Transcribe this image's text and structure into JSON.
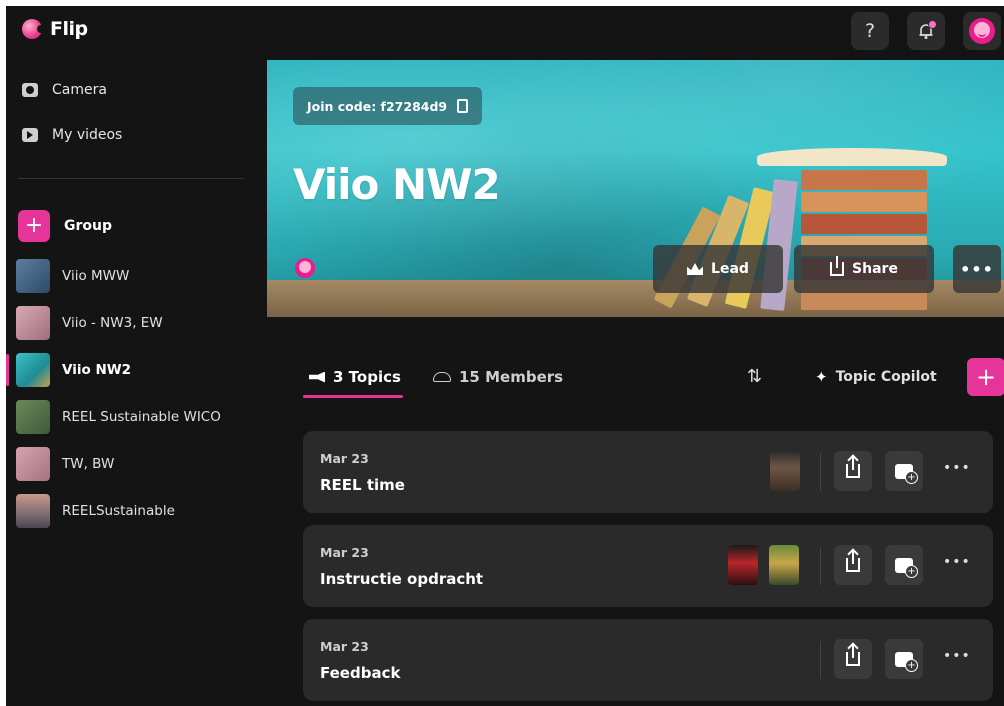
{
  "app": {
    "name": "Flip"
  },
  "topbar": {
    "help_icon": "?"
  },
  "sidebar": {
    "links": [
      {
        "label": "Camera",
        "icon": "camera-icon"
      },
      {
        "label": "My videos",
        "icon": "video-icon"
      }
    ],
    "group_add_label": "Group",
    "groups": [
      {
        "label": "Viio MWW",
        "active": false
      },
      {
        "label": "Viio - NW3, EW",
        "active": false
      },
      {
        "label": "Viio NW2",
        "active": true
      },
      {
        "label": "REEL Sustainable WICO",
        "active": false
      },
      {
        "label": "TW, BW",
        "active": false
      },
      {
        "label": "REELSustainable",
        "active": false
      }
    ]
  },
  "hero": {
    "join_code": "Join code: f27284d9",
    "title": "Viio NW2",
    "lead_label": "Lead",
    "share_label": "Share",
    "more_label": "•••"
  },
  "tabs": {
    "topics_label": "3 Topics",
    "members_label": "15 Members",
    "sort_icon": "⇅",
    "copilot_label": "Topic Copilot",
    "add_label": "+"
  },
  "topics": [
    {
      "date": "Mar 23",
      "title": "REEL time",
      "more": "•••"
    },
    {
      "date": "Mar 23",
      "title": "Instructie opdracht",
      "more": "•••"
    },
    {
      "date": "Mar 23",
      "title": "Feedback",
      "more": "•••"
    }
  ],
  "colors": {
    "accent": "#e5359a",
    "background": "#141414",
    "card": "#2a2a2a",
    "hero": "#33c3cb"
  }
}
